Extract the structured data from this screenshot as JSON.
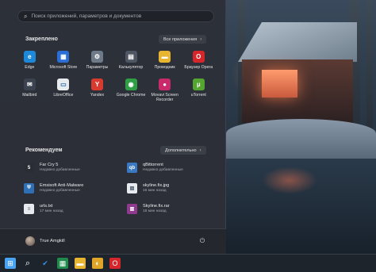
{
  "search": {
    "placeholder": "Поиск приложений, параметров и документов"
  },
  "pinned": {
    "title": "Закреплено",
    "all_apps_label": "Все приложения",
    "apps": [
      {
        "label": "Edge",
        "icon": "edge-icon",
        "color": "#1e88d8",
        "glyph": "e"
      },
      {
        "label": "Microsoft Store",
        "icon": "store-icon",
        "color": "#2b6fd6",
        "glyph": "▦"
      },
      {
        "label": "Параметры",
        "icon": "gear-icon",
        "color": "#6f7a88",
        "glyph": "⚙"
      },
      {
        "label": "Калькулятор",
        "icon": "calculator-icon",
        "color": "#4f5663",
        "glyph": "▤"
      },
      {
        "label": "Проводник",
        "icon": "folder-icon",
        "color": "#e8b531",
        "glyph": "▬"
      },
      {
        "label": "Браузер Opera",
        "icon": "opera-icon",
        "color": "#d6262b",
        "glyph": "O"
      },
      {
        "label": "Mailbird",
        "icon": "mail-icon",
        "color": "#3c4350",
        "glyph": "✉"
      },
      {
        "label": "LibreOffice",
        "icon": "document-icon",
        "color": "#e9ecef",
        "glyph": "▭"
      },
      {
        "label": "Yandex",
        "icon": "yandex-icon",
        "color": "#d93a2f",
        "glyph": "Y"
      },
      {
        "label": "Google Chrome",
        "icon": "chrome-icon",
        "color": "#2f9e44",
        "glyph": "◉"
      },
      {
        "label": "Movavi Screen Recorder",
        "icon": "recorder-icon",
        "color": "#c92a6b",
        "glyph": "●"
      },
      {
        "label": "uTorrent",
        "icon": "utorrent-icon",
        "color": "#55a630",
        "glyph": "µ"
      }
    ]
  },
  "recommended": {
    "title": "Рекомендуем",
    "more_label": "Дополнительно",
    "items": [
      {
        "name": "Far Cry 5",
        "sub": "Недавно добавленные",
        "icon": "farcry-icon",
        "color": "#2a2d33",
        "glyph": "5"
      },
      {
        "name": "qBittorrent",
        "sub": "Недавно добавленные",
        "icon": "qbittorrent-icon",
        "color": "#3a78c2",
        "glyph": "qb"
      },
      {
        "name": "Emsisoft Anti-Malware",
        "sub": "Недавно добавленные",
        "icon": "shield-icon",
        "color": "#2f6fb5",
        "glyph": "⛨"
      },
      {
        "name": "skyline.fix.jpg",
        "sub": "16 мин назад",
        "icon": "image-file-icon",
        "color": "#e7eaee",
        "glyph": "▨"
      },
      {
        "name": "urls.txt",
        "sub": "17 мин назад",
        "icon": "text-file-icon",
        "color": "#e7eaee",
        "glyph": "≡"
      },
      {
        "name": "Skyline.fix.rar",
        "sub": "18 мин назад",
        "icon": "archive-icon",
        "color": "#8e3a8e",
        "glyph": "▥"
      }
    ]
  },
  "user": {
    "name": "True Amgkill"
  },
  "taskbar": {
    "items": [
      {
        "name": "windows-start-icon",
        "color": "#4aa3f0",
        "glyph": "⊞"
      },
      {
        "name": "search-icon",
        "color": "transparent",
        "glyph": "⌕"
      },
      {
        "name": "todo-check-icon",
        "color": "transparent",
        "glyph": "✔"
      },
      {
        "name": "spreadsheet-icon",
        "color": "#1f8a4c",
        "glyph": "▦"
      },
      {
        "name": "folder-icon",
        "color": "#e8b531",
        "glyph": "▬"
      },
      {
        "name": "app-icon",
        "color": "#e0a428",
        "glyph": "◐"
      },
      {
        "name": "opera-icon",
        "color": "#d6262b",
        "glyph": "O"
      }
    ]
  }
}
